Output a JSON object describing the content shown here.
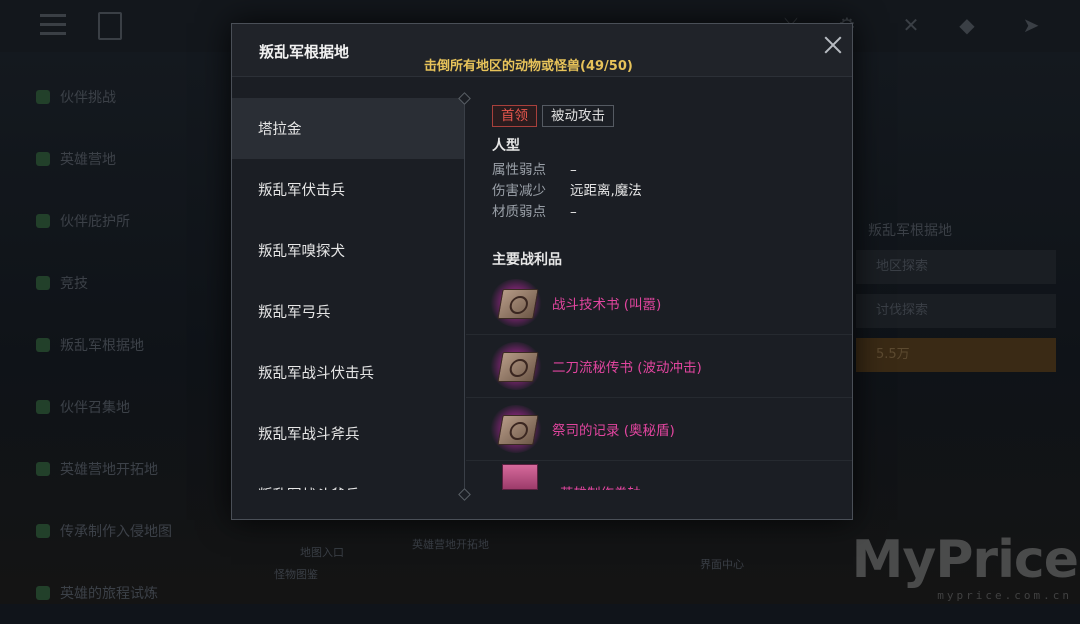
{
  "modal": {
    "title": "叛乱军根据地",
    "objective": "击倒所有地区的动物或怪兽(49/50)"
  },
  "monsters": [
    {
      "name": "塔拉金",
      "active": true
    },
    {
      "name": "叛乱军伏击兵"
    },
    {
      "name": "叛乱军嗅探犬"
    },
    {
      "name": "叛乱军弓兵"
    },
    {
      "name": "叛乱军战斗伏击兵"
    },
    {
      "name": "叛乱军战斗斧兵"
    },
    {
      "name": "叛乱军战斗斧兵"
    }
  ],
  "detail": {
    "tags": [
      "首领",
      "被动攻击"
    ],
    "race": "人型",
    "attributes": [
      {
        "key": "属性弱点",
        "value": "–"
      },
      {
        "key": "伤害减少",
        "value": "远距离,魔法"
      },
      {
        "key": "材质弱点",
        "value": "–"
      }
    ],
    "loot_title": "主要战利品",
    "loot": [
      {
        "name": "战斗技术书 (叫嚣)"
      },
      {
        "name": "二刀流秘传书 (波动冲击)"
      },
      {
        "name": "祭司的记录 (奥秘盾)"
      },
      {
        "name": "英雄制作卷轴"
      }
    ]
  },
  "background": {
    "left_menu": [
      "伙伴挑战",
      "英雄营地",
      "伙伴庇护所",
      "竞技",
      "叛乱军根据地",
      "伙伴召集地",
      "英雄营地开拓地",
      "传承制作入侵地图",
      "英雄的旅程试炼"
    ],
    "right_panel": {
      "title": "叛乱军根据地",
      "rows": [
        "地区探索",
        "讨伐探索",
        "5.5万"
      ]
    },
    "bottom": [
      "地图入口",
      "英雄营地开拓地",
      "界面中心",
      "怪物图鉴"
    ]
  },
  "watermark": {
    "brand": "MyPrice",
    "url": "myprice.com.cn"
  },
  "colors": {
    "objective": "#e7c35a",
    "boss_tag": "#e9574e",
    "loot_purple": "#e2459f",
    "modal_bg": "#1b1e24"
  }
}
